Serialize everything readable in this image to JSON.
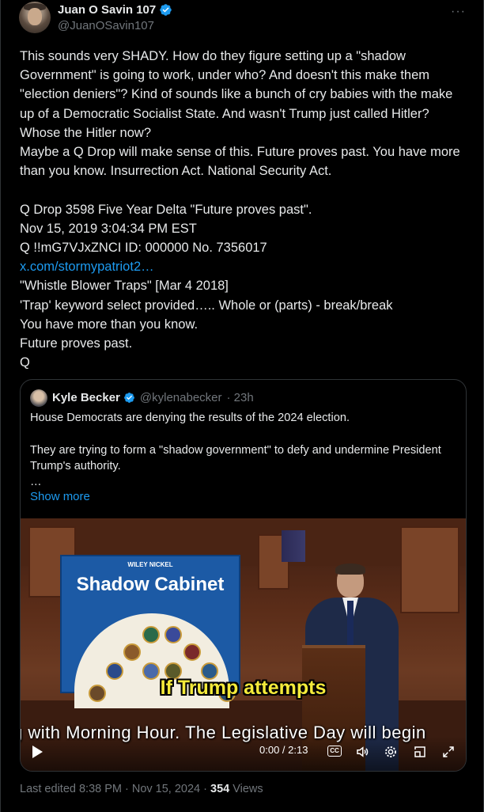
{
  "author": {
    "name": "Juan O Savin 107",
    "handle": "@JuanOSavin107",
    "verified": true
  },
  "more_icon": "more-horizontal-icon",
  "body_lines": {
    "p1": "This sounds very SHADY. How do they figure setting up a \"shadow Government\" is going to work, under who? And doesn't this make them \"election deniers\"? Kind of sounds like a bunch of cry babies with the make up of a Democratic Socialist State. And wasn't Trump just called Hitler? Whose the Hitler now?\nMaybe a Q Drop will make sense of this. Future proves past. You have more than you know. Insurrection Act. National Security Act.\n\nQ Drop 3598 Five Year Delta \"Future proves past\".\nNov 15, 2019 3:04:34 PM EST\nQ !!mG7VJxZNCI ID: 000000 No. 7356017\n",
    "link": "x.com/stormypatriot2…",
    "p2": "\n\"Whistle Blower Traps\" [Mar 4 2018]\n'Trap' keyword select provided….. Whole or (parts) - break/break\nYou have more than you know.\nFuture proves past.\nQ"
  },
  "quote": {
    "name": "Kyle Becker",
    "handle": "@kylenabecker",
    "time": "· 23h",
    "text": "House Democrats are denying the results of the 2024 election.\n\nThey are trying to form a \"shadow government\" to defy and undermine President Trump's authority.\n…",
    "show_more": "Show more",
    "video": {
      "poster_small": "WILEY NICKEL",
      "poster_title": "Shadow Cabinet",
      "caption_highlight": "If Trump attempts",
      "caption_scroll": "g with Morning Hour.  The Legislative Day will begin",
      "time": "0:00 / 2:13",
      "cc": "CC"
    }
  },
  "footer": {
    "edited": "Last edited 8:38 PM · Nov 15, 2024 · ",
    "views_count": "354",
    "views_label": " Views"
  }
}
